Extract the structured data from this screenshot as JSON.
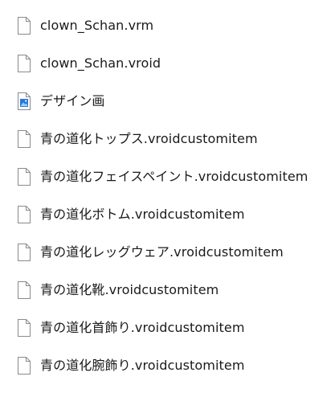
{
  "files": [
    {
      "name": "clown_Schan.vrm",
      "icon": "blank-file-icon"
    },
    {
      "name": "clown_Schan.vroid",
      "icon": "blank-file-icon"
    },
    {
      "name": "デザイン画",
      "icon": "image-file-icon"
    },
    {
      "name": "青の道化トップス.vroidcustomitem",
      "icon": "blank-file-icon"
    },
    {
      "name": "青の道化フェイスペイント.vroidcustomitem",
      "icon": "blank-file-icon"
    },
    {
      "name": "青の道化ボトム.vroidcustomitem",
      "icon": "blank-file-icon"
    },
    {
      "name": "青の道化レッグウェア.vroidcustomitem",
      "icon": "blank-file-icon"
    },
    {
      "name": "青の道化靴.vroidcustomitem",
      "icon": "blank-file-icon"
    },
    {
      "name": "青の道化首飾り.vroidcustomitem",
      "icon": "blank-file-icon"
    },
    {
      "name": "青の道化腕飾り.vroidcustomitem",
      "icon": "blank-file-icon"
    }
  ],
  "colors": {
    "text": "#1a1a1a",
    "icon_outline": "#8a8a8a",
    "image_icon_accent": "#2b78d8"
  }
}
